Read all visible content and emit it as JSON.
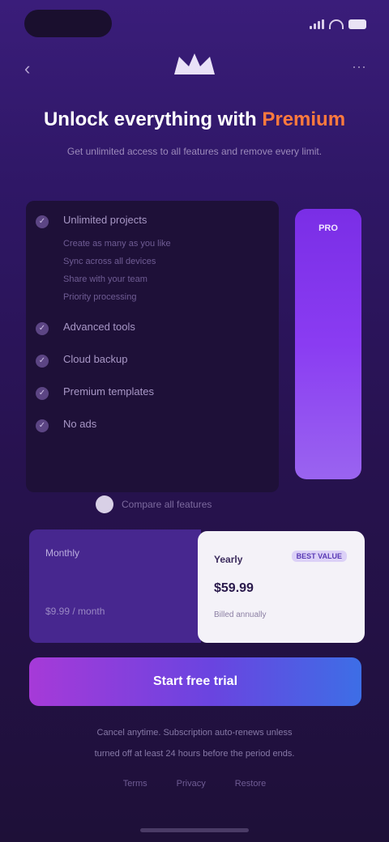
{
  "status_bar": {
    "time": ""
  },
  "header": {
    "back_icon": "‹",
    "more_icon": "···"
  },
  "title": {
    "main": "Unlock everything with",
    "highlight": "Premium"
  },
  "subtitle": "Get unlimited access to all features and remove every limit.",
  "features": [
    {
      "icon": "✓",
      "label": "Unlimited projects",
      "desc": [
        "Create as many as you like",
        "Sync across all devices",
        "Share with your team",
        "Priority processing"
      ]
    },
    {
      "icon": "✓",
      "label": "Advanced tools"
    },
    {
      "icon": "✓",
      "label": "Cloud backup"
    },
    {
      "icon": "✓",
      "label": "Premium templates"
    },
    {
      "icon": "✓",
      "label": "No ads"
    }
  ],
  "side_column_label": "PRO",
  "compare_text": "Compare all features",
  "plans": {
    "monthly": {
      "name": "Monthly",
      "price": "$9.99 / month"
    },
    "yearly": {
      "badge": "BEST VALUE",
      "name": "Yearly",
      "price": "$59.99",
      "note": "Billed annually"
    }
  },
  "cta_label": "Start free trial",
  "legal": {
    "line1": "Cancel anytime. Subscription auto-renews unless",
    "line2": "turned off at least 24 hours before the period ends."
  },
  "links": [
    "Terms",
    "Privacy",
    "Restore"
  ],
  "colors": {
    "accent": "#8a3cf2",
    "highlight": "#ff7a3d",
    "cta_start": "#a63ad8",
    "cta_end": "#3d6ee6"
  }
}
